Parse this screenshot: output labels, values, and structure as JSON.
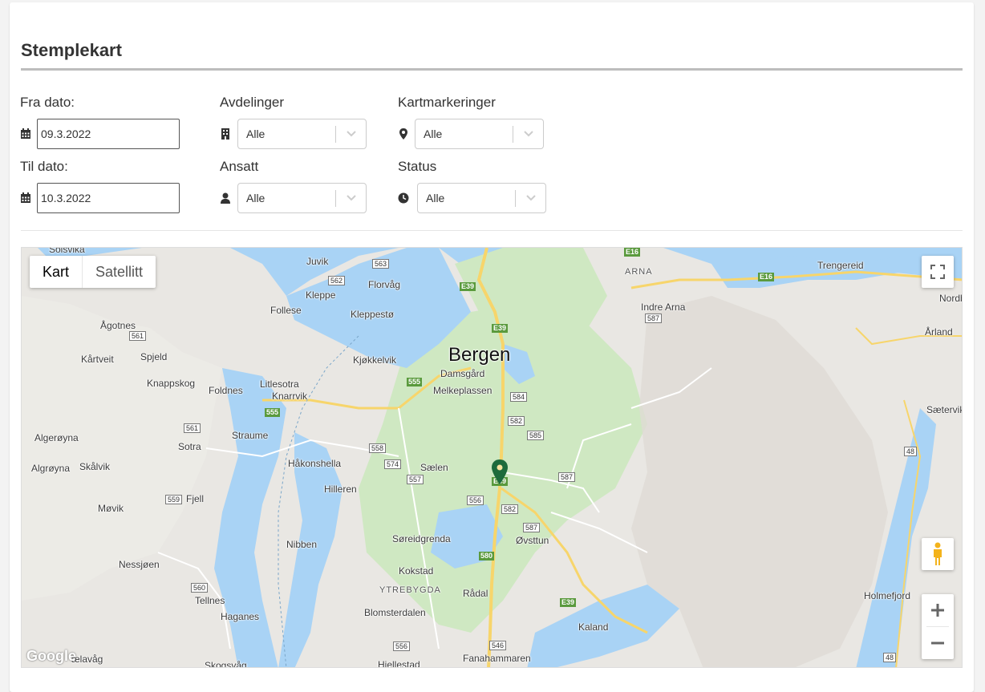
{
  "page": {
    "title": "Stemplekart"
  },
  "filters": {
    "from_date": {
      "label": "Fra dato:",
      "value": "09.3.2022"
    },
    "to_date": {
      "label": "Til dato:",
      "value": "10.3.2022"
    },
    "departments": {
      "label": "Avdelinger",
      "value": "Alle"
    },
    "employee": {
      "label": "Ansatt",
      "value": "Alle"
    },
    "map_markers": {
      "label": "Kartmarkeringer",
      "value": "Alle"
    },
    "status": {
      "label": "Status",
      "value": "Alle"
    }
  },
  "map": {
    "type_buttons": [
      "Kart",
      "Satellitt"
    ],
    "active_type": "Kart",
    "attribution": "Google",
    "labels": {
      "solsvika": "Solsvika",
      "juvik": "Juvik",
      "florvag": "Florvåg",
      "kleppe": "Kleppe",
      "follese": "Follese",
      "kleppesto": "Kleppestø",
      "agotnes": "Ågotnes",
      "kartveit": "Kårtveit",
      "spjeld": "Spjeld",
      "kjokkelvik": "Kjøkkelvik",
      "bergen": "Bergen",
      "damsgard": "Damsgård",
      "melkeplassen": "Melkeplassen",
      "knappskog": "Knappskog",
      "foldnes": "Foldnes",
      "litlesotra": "Litlesotra",
      "knarrvik": "Knarrvik",
      "algeroyna": "Algerøyna",
      "straume": "Straume",
      "sotra": "Sotra",
      "skalvik": "Skålvik",
      "algroyna": "Algrøyna",
      "hakonshella": "Håkonshella",
      "saelen": "Sælen",
      "hilleren": "Hilleren",
      "movik": "Møvik",
      "fjell": "Fjell",
      "soreidgrenda": "Søreidgrenda",
      "ovsttun": "Øvsttun",
      "nibben": "Nibben",
      "nessjoen": "Nessjøen",
      "kokstad": "Kokstad",
      "ytrebygda": "YTREBYGDA",
      "radal": "Rådal",
      "tellnes": "Tellnes",
      "haganes": "Haganes",
      "blomsterdalen": "Blomsterdalen",
      "kaland": "Kaland",
      "aelavag": "ælavåg",
      "skogsvag": "Skogsvåg",
      "hjellestad": "Hjellestad",
      "fanahammaren": "Fanahammaren",
      "indre_arna": "Indre Arna",
      "arna": "ARNA",
      "trengereid": "Trengereid",
      "nordb": "Nordb",
      "arland": "Årland",
      "saetervik": "Sætervik",
      "holmefjord": "Holmefjord"
    },
    "roads": {
      "r563": "563",
      "r562": "562",
      "r561a": "561",
      "r561b": "561",
      "r559": "559",
      "r560": "560",
      "r558": "558",
      "r574": "574",
      "r557": "557",
      "r556a": "556",
      "r556b": "556",
      "r584": "584",
      "r582a": "582",
      "r582b": "582",
      "r585": "585",
      "r587a": "587",
      "r587b": "587",
      "r587c": "587",
      "r546": "546",
      "r48a": "48",
      "r48b": "48"
    },
    "eroutes": {
      "e16a": "E16",
      "e16b": "E16",
      "e39a": "E39",
      "e39b": "E39",
      "e39c": "E39",
      "e39d": "E39",
      "r555a": "555",
      "r555b": "555",
      "r580": "580"
    },
    "marker_color": "#1e6b3c"
  }
}
